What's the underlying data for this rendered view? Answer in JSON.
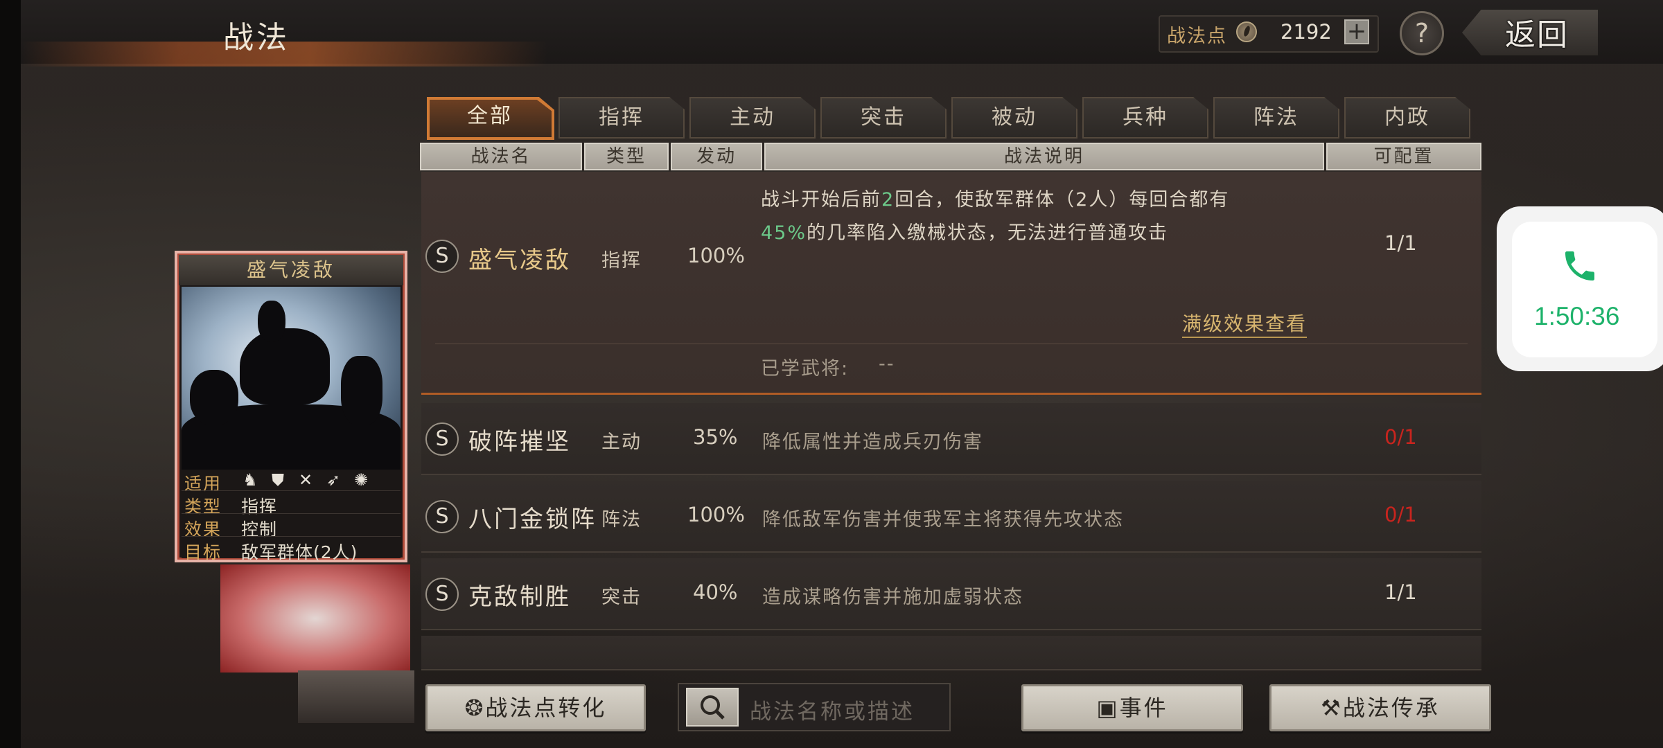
{
  "header": {
    "title": "战法",
    "points_label": "战法点",
    "points_value": "2192",
    "plus_label": "+",
    "help_label": "?",
    "back_label": "返回"
  },
  "tabs": [
    {
      "label": "全部",
      "active": true
    },
    {
      "label": "指挥"
    },
    {
      "label": "主动"
    },
    {
      "label": "突击"
    },
    {
      "label": "被动"
    },
    {
      "label": "兵种"
    },
    {
      "label": "阵法"
    },
    {
      "label": "内政"
    }
  ],
  "columns": [
    "战法名",
    "类型",
    "发动",
    "战法说明",
    "可配置"
  ],
  "skills": [
    {
      "badge": "S",
      "name": "盛气凌敌",
      "type": "指挥",
      "rate": "100%",
      "desc_line1": "战斗开始后前2回合，使敌军群体（2人）每回合都有",
      "desc_line2": "45%的几率陷入缴械状态，无法进行普通攻击",
      "config": "1/1",
      "full_effect_link": "满级效果查看",
      "learned_label": "已学武将:",
      "learned_value": "--"
    },
    {
      "badge": "S",
      "name": "破阵摧坚",
      "type": "主动",
      "rate": "35%",
      "desc": "降低属性并造成兵刃伤害",
      "config": "0/1"
    },
    {
      "badge": "S",
      "name": "八门金锁阵",
      "type": "阵法",
      "rate": "100%",
      "desc": "降低敌军伤害并使我军主将获得先攻状态",
      "config": "0/1"
    },
    {
      "badge": "S",
      "name": "克敌制胜",
      "type": "突击",
      "rate": "40%",
      "desc": "造成谋略伤害并施加虚弱状态",
      "config": "1/1"
    }
  ],
  "card": {
    "title": "盛气凌敌",
    "apply_label": "适用",
    "unit_icons": [
      "cavalry-icon",
      "shield-icon",
      "bow-icon",
      "spear-icon",
      "siege-icon"
    ],
    "type_label": "类型",
    "type_value": "指挥",
    "effect_label": "效果",
    "effect_value": "控制",
    "target_label": "目标",
    "target_value": "敌军群体(2人)"
  },
  "bottom": {
    "convert_label": "战法点转化",
    "search_placeholder": "战法名称或描述",
    "events_label": "事件",
    "inherit_label": "战法传承"
  },
  "call_widget": {
    "time": "1:50:36"
  },
  "colors": {
    "accent": "#c8742f",
    "gold": "#d7b56f",
    "highlight_green": "#6cc98a",
    "red": "#c9241e",
    "call_green": "#1db26a"
  }
}
